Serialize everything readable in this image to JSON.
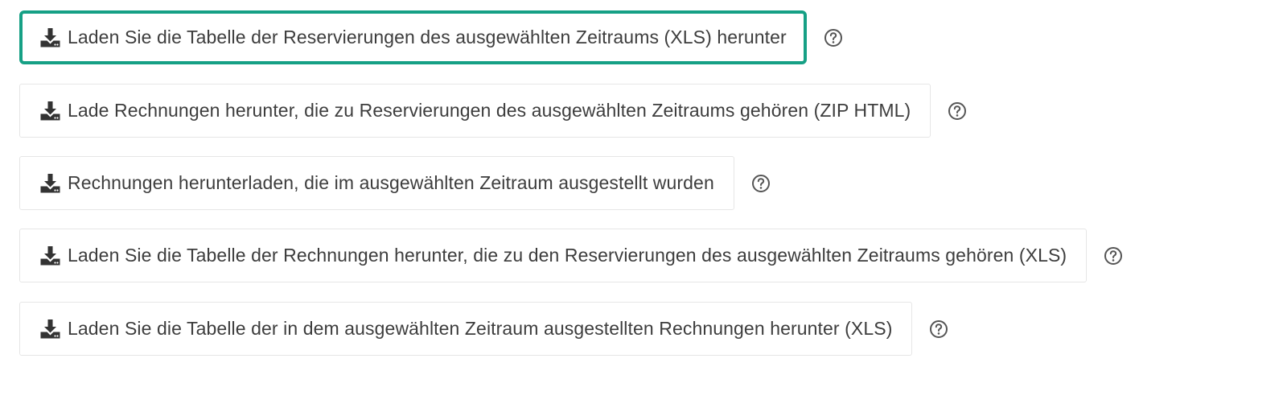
{
  "colors": {
    "active_border": "#16a085",
    "button_border": "#e6e6e6",
    "text": "#3d3d3d",
    "icon": "#333333",
    "help_icon": "#555555"
  },
  "downloads": [
    {
      "label": "Laden Sie die Tabelle der Reservierungen des ausgewählten Zeitraums (XLS) herunter",
      "icon": "download-icon",
      "help_icon": "question-circle-icon",
      "active": true
    },
    {
      "label": "Lade Rechnungen herunter, die zu Reservierungen des ausgewählten Zeitraums gehören (ZIP HTML)",
      "icon": "download-icon",
      "help_icon": "question-circle-icon",
      "active": false
    },
    {
      "label": "Rechnungen herunterladen, die im ausgewählten Zeitraum ausgestellt wurden",
      "icon": "download-icon",
      "help_icon": "question-circle-icon",
      "active": false
    },
    {
      "label": "Laden Sie die Tabelle der Rechnungen herunter, die zu den Reservierungen des ausgewählten Zeitraums gehören (XLS)",
      "icon": "download-icon",
      "help_icon": "question-circle-icon",
      "active": false
    },
    {
      "label": "Laden Sie die Tabelle der in dem ausgewählten Zeitraum ausgestellten Rechnungen herunter (XLS)",
      "icon": "download-icon",
      "help_icon": "question-circle-icon",
      "active": false
    }
  ]
}
